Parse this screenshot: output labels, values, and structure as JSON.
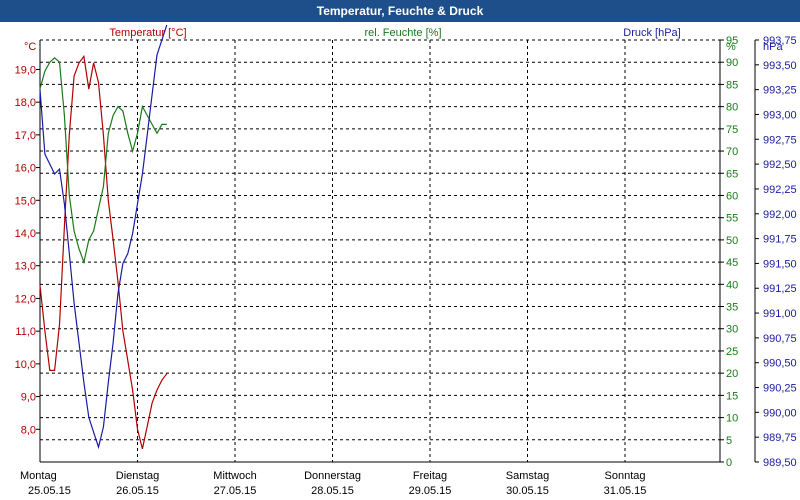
{
  "window": {
    "title": "Temperatur, Feuchte & Druck"
  },
  "chart_data": {
    "type": "line",
    "title": "Temperatur, Feuchte & Druck",
    "colors": {
      "temperature": "#b30000",
      "humidity": "#1a7a1a",
      "pressure": "#1a1aa6",
      "title_bar": "#1f4f8a"
    },
    "grid": true,
    "axes": {
      "left": {
        "unit": "°C",
        "label": "Temperatur [°C]",
        "ylim": [
          7.0,
          19.9
        ],
        "ticks": [
          "8,0",
          "9,0",
          "10,0",
          "11,0",
          "12,0",
          "13,0",
          "14,0",
          "15,0",
          "16,0",
          "17,0",
          "18,0",
          "19,0"
        ]
      },
      "middle": {
        "unit": "%",
        "label": "rel. Feuchte [%]",
        "ylim": [
          0,
          95
        ],
        "ticks": [
          "0",
          "5",
          "10",
          "15",
          "20",
          "25",
          "30",
          "35",
          "40",
          "45",
          "50",
          "55",
          "60",
          "65",
          "70",
          "75",
          "80",
          "85",
          "90",
          "95"
        ]
      },
      "right": {
        "unit": "hPa",
        "label": "Druck [hPa]",
        "ylim": [
          989.5,
          993.75
        ],
        "ticks": [
          "989,50",
          "989,75",
          "990,00",
          "990,25",
          "990,50",
          "990,75",
          "991,00",
          "991,25",
          "991,50",
          "991,75",
          "992,00",
          "992,25",
          "992,50",
          "992,75",
          "993,00",
          "993,25",
          "993,50",
          "993,75"
        ]
      }
    },
    "x_categories": [
      {
        "day": "Montag",
        "date": "25.05.15"
      },
      {
        "day": "Dienstag",
        "date": "26.05.15"
      },
      {
        "day": "Mittwoch",
        "date": "27.05.15"
      },
      {
        "day": "Donnerstag",
        "date": "28.05.15"
      },
      {
        "day": "Freitag",
        "date": "29.05.15"
      },
      {
        "day": "Samstag",
        "date": "30.05.15"
      },
      {
        "day": "Sonntag",
        "date": "31.05.15"
      }
    ],
    "series": [
      {
        "name": "Temperatur [°C]",
        "axis": "left",
        "color": "#b30000",
        "x": [
          0.0,
          0.05,
          0.1,
          0.15,
          0.2,
          0.25,
          0.3,
          0.35,
          0.4,
          0.45,
          0.5,
          0.55,
          0.6,
          0.65,
          0.7,
          0.75,
          0.8,
          0.85,
          0.9,
          0.95,
          1.0,
          1.05,
          1.1,
          1.15,
          1.2,
          1.25,
          1.3
        ],
        "y": [
          12.4,
          11.0,
          9.8,
          9.8,
          11.2,
          14.2,
          17.0,
          18.8,
          19.2,
          19.4,
          18.4,
          19.2,
          18.6,
          17.0,
          15.0,
          13.8,
          12.5,
          11.0,
          10.1,
          9.2,
          8.0,
          7.4,
          8.1,
          8.8,
          9.2,
          9.5,
          9.7
        ]
      },
      {
        "name": "rel. Feuchte [%]",
        "axis": "middle",
        "color": "#1a7a1a",
        "x": [
          0.0,
          0.05,
          0.1,
          0.15,
          0.2,
          0.25,
          0.3,
          0.35,
          0.4,
          0.45,
          0.5,
          0.55,
          0.6,
          0.65,
          0.7,
          0.75,
          0.8,
          0.85,
          0.9,
          0.95,
          1.0,
          1.05,
          1.1,
          1.15,
          1.2,
          1.25,
          1.3
        ],
        "y": [
          84,
          88,
          90,
          91,
          90,
          78,
          60,
          52,
          48,
          45,
          50,
          52,
          57,
          62,
          74,
          78,
          80,
          79,
          74,
          70,
          74,
          80,
          78,
          76,
          74,
          76,
          76
        ]
      },
      {
        "name": "Druck [hPa]",
        "axis": "right",
        "color": "#1a1aa6",
        "x": [
          0.0,
          0.05,
          0.1,
          0.15,
          0.2,
          0.25,
          0.3,
          0.35,
          0.4,
          0.45,
          0.5,
          0.55,
          0.6,
          0.65,
          0.7,
          0.75,
          0.8,
          0.85,
          0.9,
          0.95,
          1.0,
          1.05,
          1.1,
          1.15,
          1.2,
          1.25,
          1.3
        ],
        "y": [
          993.25,
          992.6,
          992.5,
          992.4,
          992.45,
          992.1,
          991.6,
          991.1,
          990.7,
          990.3,
          989.95,
          989.8,
          989.65,
          989.85,
          990.3,
          990.7,
          991.2,
          991.5,
          991.6,
          991.8,
          992.1,
          992.4,
          992.8,
          993.2,
          993.6,
          993.75,
          993.9
        ]
      }
    ]
  }
}
